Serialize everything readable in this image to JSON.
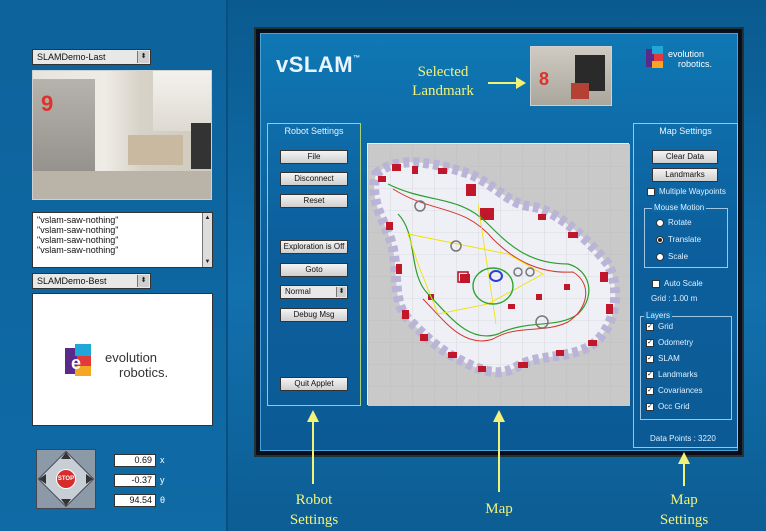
{
  "left_panel": {
    "camera_selector_top": "SLAMDemo-Last",
    "camera_top_landmark_number": "9",
    "log_lines": [
      "\"vslam-saw-nothing\"",
      "\"vslam-saw-nothing\"",
      "\"vslam-saw-nothing\"",
      "\"vslam-saw-nothing\""
    ],
    "camera_selector_bottom": "SLAMDemo-Best",
    "logo_line1": "evolution",
    "logo_line2": "robotics.",
    "stop_label": "STOP",
    "pose": [
      {
        "value": "0.69",
        "axis": "x"
      },
      {
        "value": "-0.37",
        "axis": "y"
      },
      {
        "value": "94.54",
        "axis": "θ"
      }
    ]
  },
  "header": {
    "title": "vSLAM",
    "trademark": "™",
    "selected_landmark_line1": "Selected",
    "selected_landmark_line2": "Landmark",
    "selected_landmark_number": "8",
    "logo_line1": "evolution",
    "logo_line2": "robotics."
  },
  "robot_settings": {
    "title": "Robot Settings",
    "buttons": [
      "File",
      "Disconnect",
      "Reset",
      "Exploration is Off",
      "Goto"
    ],
    "mode_select": "Normal",
    "debug_button": "Debug Msg",
    "quit_button": "Quit Applet"
  },
  "map_settings": {
    "title": "Map Settings",
    "clear_button": "Clear Data",
    "landmarks_button": "Landmarks",
    "multiple_waypoints": "Multiple Waypoints",
    "mouse_section_title": "Mouse Motion",
    "mouse_options": [
      {
        "label": "Rotate",
        "selected": false
      },
      {
        "label": "Translate",
        "selected": true
      },
      {
        "label": "Scale",
        "selected": false
      }
    ],
    "auto_scale": "Auto Scale",
    "grid_text": "Grid : 1.00 m",
    "layers_title": "Layers",
    "layers": [
      "Grid",
      "Odometry",
      "SLAM",
      "Landmarks",
      "Covariances",
      "Occ Grid"
    ],
    "data_points": "Data Points : 3220"
  },
  "callouts": {
    "robot_settings_line1": "Robot",
    "robot_settings_line2": "Settings",
    "map": "Map",
    "map_settings_line1": "Map",
    "map_settings_line2": "Settings"
  },
  "colors": {
    "accent_yellow": "#f2f27a",
    "group_border": "#a8d27a",
    "panel_blue": "#0f6aa5",
    "landmark_number": "#e0302a"
  }
}
